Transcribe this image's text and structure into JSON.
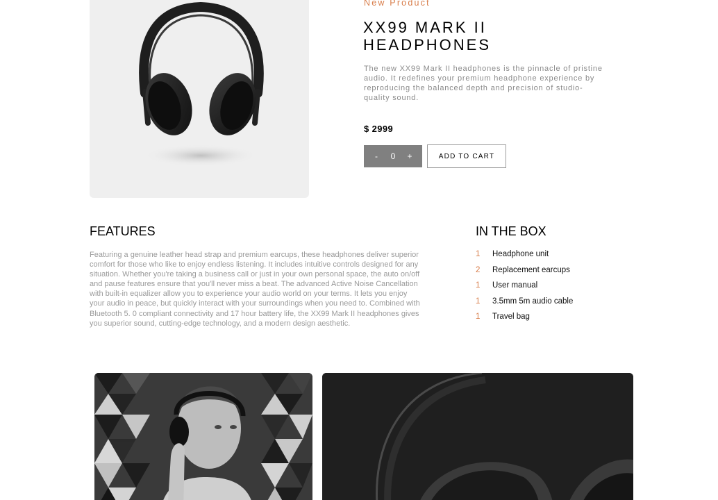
{
  "product": {
    "new_label": "New Product",
    "title": "XX99 MARK II HEADPHONES",
    "description": "The new XX99 Mark II headphones is the pinnacle of pristine audio. It redefines your premium headphone experience by reproducing the balanced depth and precision of studio-quality sound.",
    "price": "$ 2999",
    "image_icon": "headphones-product-image"
  },
  "cart": {
    "decrement_label": "-",
    "quantity": "0",
    "increment_label": "+",
    "add_to_cart_label": "ADD TO CART"
  },
  "features": {
    "heading": "FEATURES",
    "text": "Featuring a genuine leather head strap and premium earcups, these headphones deliver superior comfort for those who like to enjoy endless listening. It includes intuitive controls designed for any situation. Whether you're taking a business call or just in your own personal space, the auto on/off and pause features ensure that you'll never miss a beat. The advanced Active Noise Cancellation with built-in equalizer allow you to experience your audio world on your terms. It lets you enjoy your audio in peace, but quickly interact with your surroundings when you need to. Combined with Bluetooth 5. 0 compliant connectivity and 17 hour battery life, the XX99 Mark II headphones gives you superior sound, cutting-edge technology, and a modern design aesthetic."
  },
  "in_the_box": {
    "heading": "IN THE BOX",
    "items": [
      {
        "qty": "1",
        "name": "Headphone unit"
      },
      {
        "qty": "2",
        "name": "Replacement earcups"
      },
      {
        "qty": "1",
        "name": "User manual"
      },
      {
        "qty": "1",
        "name": "3.5mm 5m audio cable"
      },
      {
        "qty": "1",
        "name": "Travel bag"
      }
    ]
  },
  "colors": {
    "accent": "#d87d4a",
    "stepper_bg": "#808080",
    "image_bg": "#efefef"
  }
}
